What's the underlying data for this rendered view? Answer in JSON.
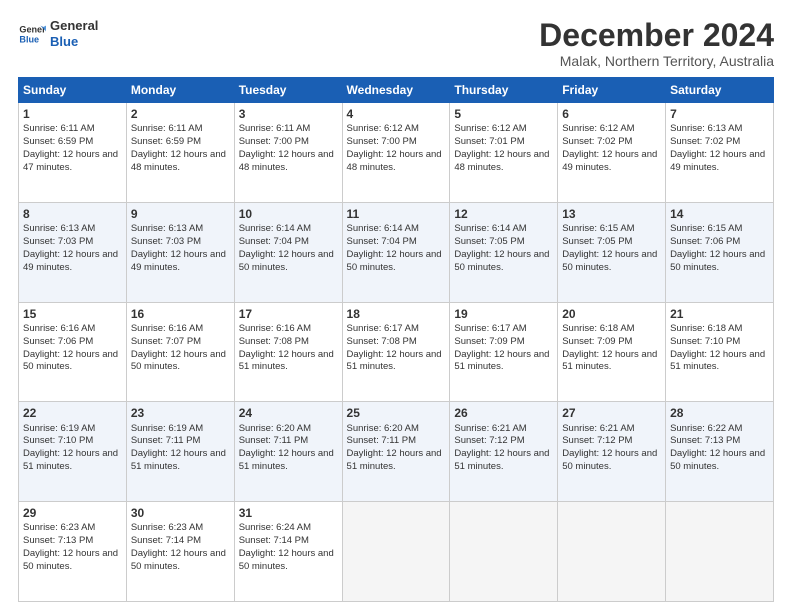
{
  "logo": {
    "line1": "General",
    "line2": "Blue"
  },
  "title": "December 2024",
  "subtitle": "Malak, Northern Territory, Australia",
  "days_of_week": [
    "Sunday",
    "Monday",
    "Tuesday",
    "Wednesday",
    "Thursday",
    "Friday",
    "Saturday"
  ],
  "weeks": [
    [
      {
        "day": "1",
        "rise": "Sunrise: 6:11 AM",
        "set": "Sunset: 6:59 PM",
        "daylight": "Daylight: 12 hours and 47 minutes."
      },
      {
        "day": "2",
        "rise": "Sunrise: 6:11 AM",
        "set": "Sunset: 6:59 PM",
        "daylight": "Daylight: 12 hours and 48 minutes."
      },
      {
        "day": "3",
        "rise": "Sunrise: 6:11 AM",
        "set": "Sunset: 7:00 PM",
        "daylight": "Daylight: 12 hours and 48 minutes."
      },
      {
        "day": "4",
        "rise": "Sunrise: 6:12 AM",
        "set": "Sunset: 7:00 PM",
        "daylight": "Daylight: 12 hours and 48 minutes."
      },
      {
        "day": "5",
        "rise": "Sunrise: 6:12 AM",
        "set": "Sunset: 7:01 PM",
        "daylight": "Daylight: 12 hours and 48 minutes."
      },
      {
        "day": "6",
        "rise": "Sunrise: 6:12 AM",
        "set": "Sunset: 7:02 PM",
        "daylight": "Daylight: 12 hours and 49 minutes."
      },
      {
        "day": "7",
        "rise": "Sunrise: 6:13 AM",
        "set": "Sunset: 7:02 PM",
        "daylight": "Daylight: 12 hours and 49 minutes."
      }
    ],
    [
      {
        "day": "8",
        "rise": "Sunrise: 6:13 AM",
        "set": "Sunset: 7:03 PM",
        "daylight": "Daylight: 12 hours and 49 minutes."
      },
      {
        "day": "9",
        "rise": "Sunrise: 6:13 AM",
        "set": "Sunset: 7:03 PM",
        "daylight": "Daylight: 12 hours and 49 minutes."
      },
      {
        "day": "10",
        "rise": "Sunrise: 6:14 AM",
        "set": "Sunset: 7:04 PM",
        "daylight": "Daylight: 12 hours and 50 minutes."
      },
      {
        "day": "11",
        "rise": "Sunrise: 6:14 AM",
        "set": "Sunset: 7:04 PM",
        "daylight": "Daylight: 12 hours and 50 minutes."
      },
      {
        "day": "12",
        "rise": "Sunrise: 6:14 AM",
        "set": "Sunset: 7:05 PM",
        "daylight": "Daylight: 12 hours and 50 minutes."
      },
      {
        "day": "13",
        "rise": "Sunrise: 6:15 AM",
        "set": "Sunset: 7:05 PM",
        "daylight": "Daylight: 12 hours and 50 minutes."
      },
      {
        "day": "14",
        "rise": "Sunrise: 6:15 AM",
        "set": "Sunset: 7:06 PM",
        "daylight": "Daylight: 12 hours and 50 minutes."
      }
    ],
    [
      {
        "day": "15",
        "rise": "Sunrise: 6:16 AM",
        "set": "Sunset: 7:06 PM",
        "daylight": "Daylight: 12 hours and 50 minutes."
      },
      {
        "day": "16",
        "rise": "Sunrise: 6:16 AM",
        "set": "Sunset: 7:07 PM",
        "daylight": "Daylight: 12 hours and 50 minutes."
      },
      {
        "day": "17",
        "rise": "Sunrise: 6:16 AM",
        "set": "Sunset: 7:08 PM",
        "daylight": "Daylight: 12 hours and 51 minutes."
      },
      {
        "day": "18",
        "rise": "Sunrise: 6:17 AM",
        "set": "Sunset: 7:08 PM",
        "daylight": "Daylight: 12 hours and 51 minutes."
      },
      {
        "day": "19",
        "rise": "Sunrise: 6:17 AM",
        "set": "Sunset: 7:09 PM",
        "daylight": "Daylight: 12 hours and 51 minutes."
      },
      {
        "day": "20",
        "rise": "Sunrise: 6:18 AM",
        "set": "Sunset: 7:09 PM",
        "daylight": "Daylight: 12 hours and 51 minutes."
      },
      {
        "day": "21",
        "rise": "Sunrise: 6:18 AM",
        "set": "Sunset: 7:10 PM",
        "daylight": "Daylight: 12 hours and 51 minutes."
      }
    ],
    [
      {
        "day": "22",
        "rise": "Sunrise: 6:19 AM",
        "set": "Sunset: 7:10 PM",
        "daylight": "Daylight: 12 hours and 51 minutes."
      },
      {
        "day": "23",
        "rise": "Sunrise: 6:19 AM",
        "set": "Sunset: 7:11 PM",
        "daylight": "Daylight: 12 hours and 51 minutes."
      },
      {
        "day": "24",
        "rise": "Sunrise: 6:20 AM",
        "set": "Sunset: 7:11 PM",
        "daylight": "Daylight: 12 hours and 51 minutes."
      },
      {
        "day": "25",
        "rise": "Sunrise: 6:20 AM",
        "set": "Sunset: 7:11 PM",
        "daylight": "Daylight: 12 hours and 51 minutes."
      },
      {
        "day": "26",
        "rise": "Sunrise: 6:21 AM",
        "set": "Sunset: 7:12 PM",
        "daylight": "Daylight: 12 hours and 51 minutes."
      },
      {
        "day": "27",
        "rise": "Sunrise: 6:21 AM",
        "set": "Sunset: 7:12 PM",
        "daylight": "Daylight: 12 hours and 50 minutes."
      },
      {
        "day": "28",
        "rise": "Sunrise: 6:22 AM",
        "set": "Sunset: 7:13 PM",
        "daylight": "Daylight: 12 hours and 50 minutes."
      }
    ],
    [
      {
        "day": "29",
        "rise": "Sunrise: 6:23 AM",
        "set": "Sunset: 7:13 PM",
        "daylight": "Daylight: 12 hours and 50 minutes."
      },
      {
        "day": "30",
        "rise": "Sunrise: 6:23 AM",
        "set": "Sunset: 7:14 PM",
        "daylight": "Daylight: 12 hours and 50 minutes."
      },
      {
        "day": "31",
        "rise": "Sunrise: 6:24 AM",
        "set": "Sunset: 7:14 PM",
        "daylight": "Daylight: 12 hours and 50 minutes."
      },
      null,
      null,
      null,
      null
    ]
  ]
}
